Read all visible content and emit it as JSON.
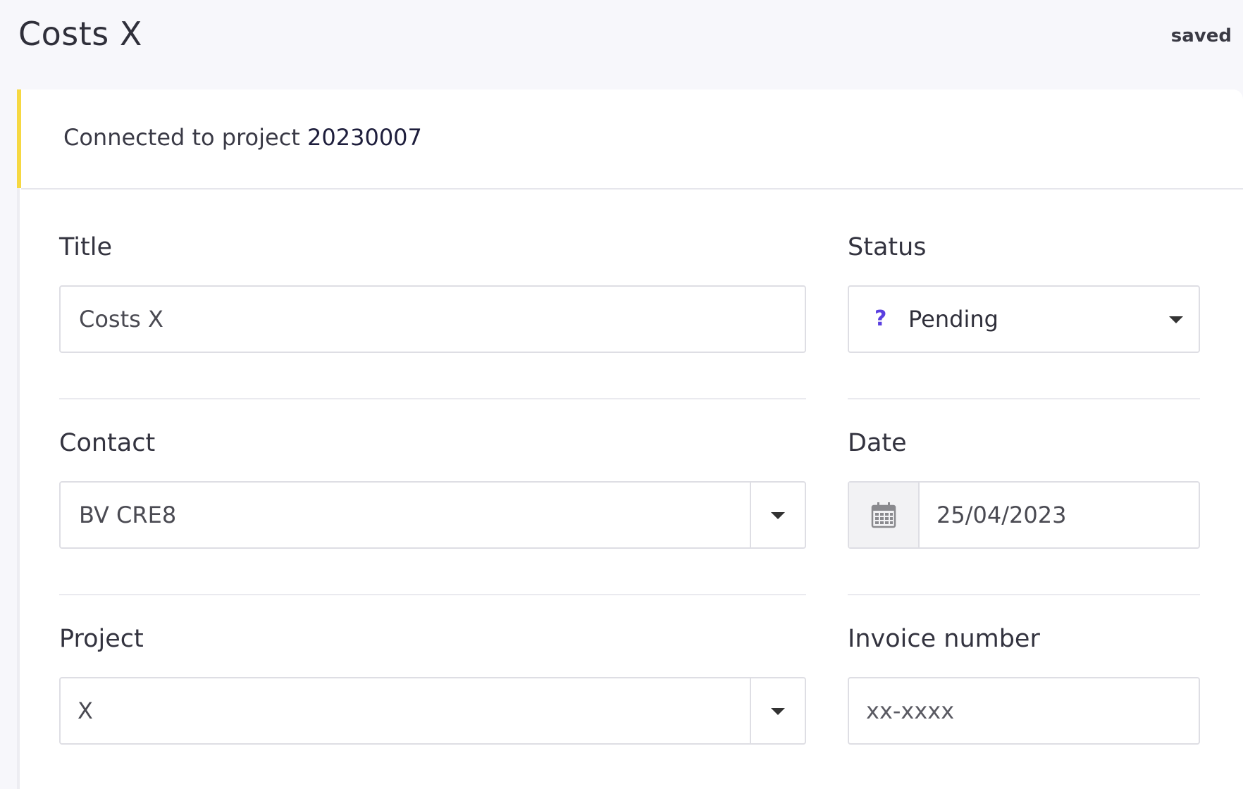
{
  "header": {
    "title": "Costs X",
    "save_status": "saved"
  },
  "notice": {
    "prefix": "Connected to project",
    "project_number": "20230007",
    "accent_color": "#f6d842"
  },
  "form": {
    "title": {
      "label": "Title",
      "value": "Costs X"
    },
    "status": {
      "label": "Status",
      "value": "Pending",
      "icon": "question-icon",
      "icon_glyph": "?",
      "icon_color": "#5a3fe0"
    },
    "contact": {
      "label": "Contact",
      "value": "BV CRE8"
    },
    "date": {
      "label": "Date",
      "value": "25/04/2023",
      "icon": "calendar-icon"
    },
    "project": {
      "label": "Project",
      "value": "X"
    },
    "invoice_number": {
      "label": "Invoice number",
      "placeholder": "xx-xxxx"
    }
  }
}
